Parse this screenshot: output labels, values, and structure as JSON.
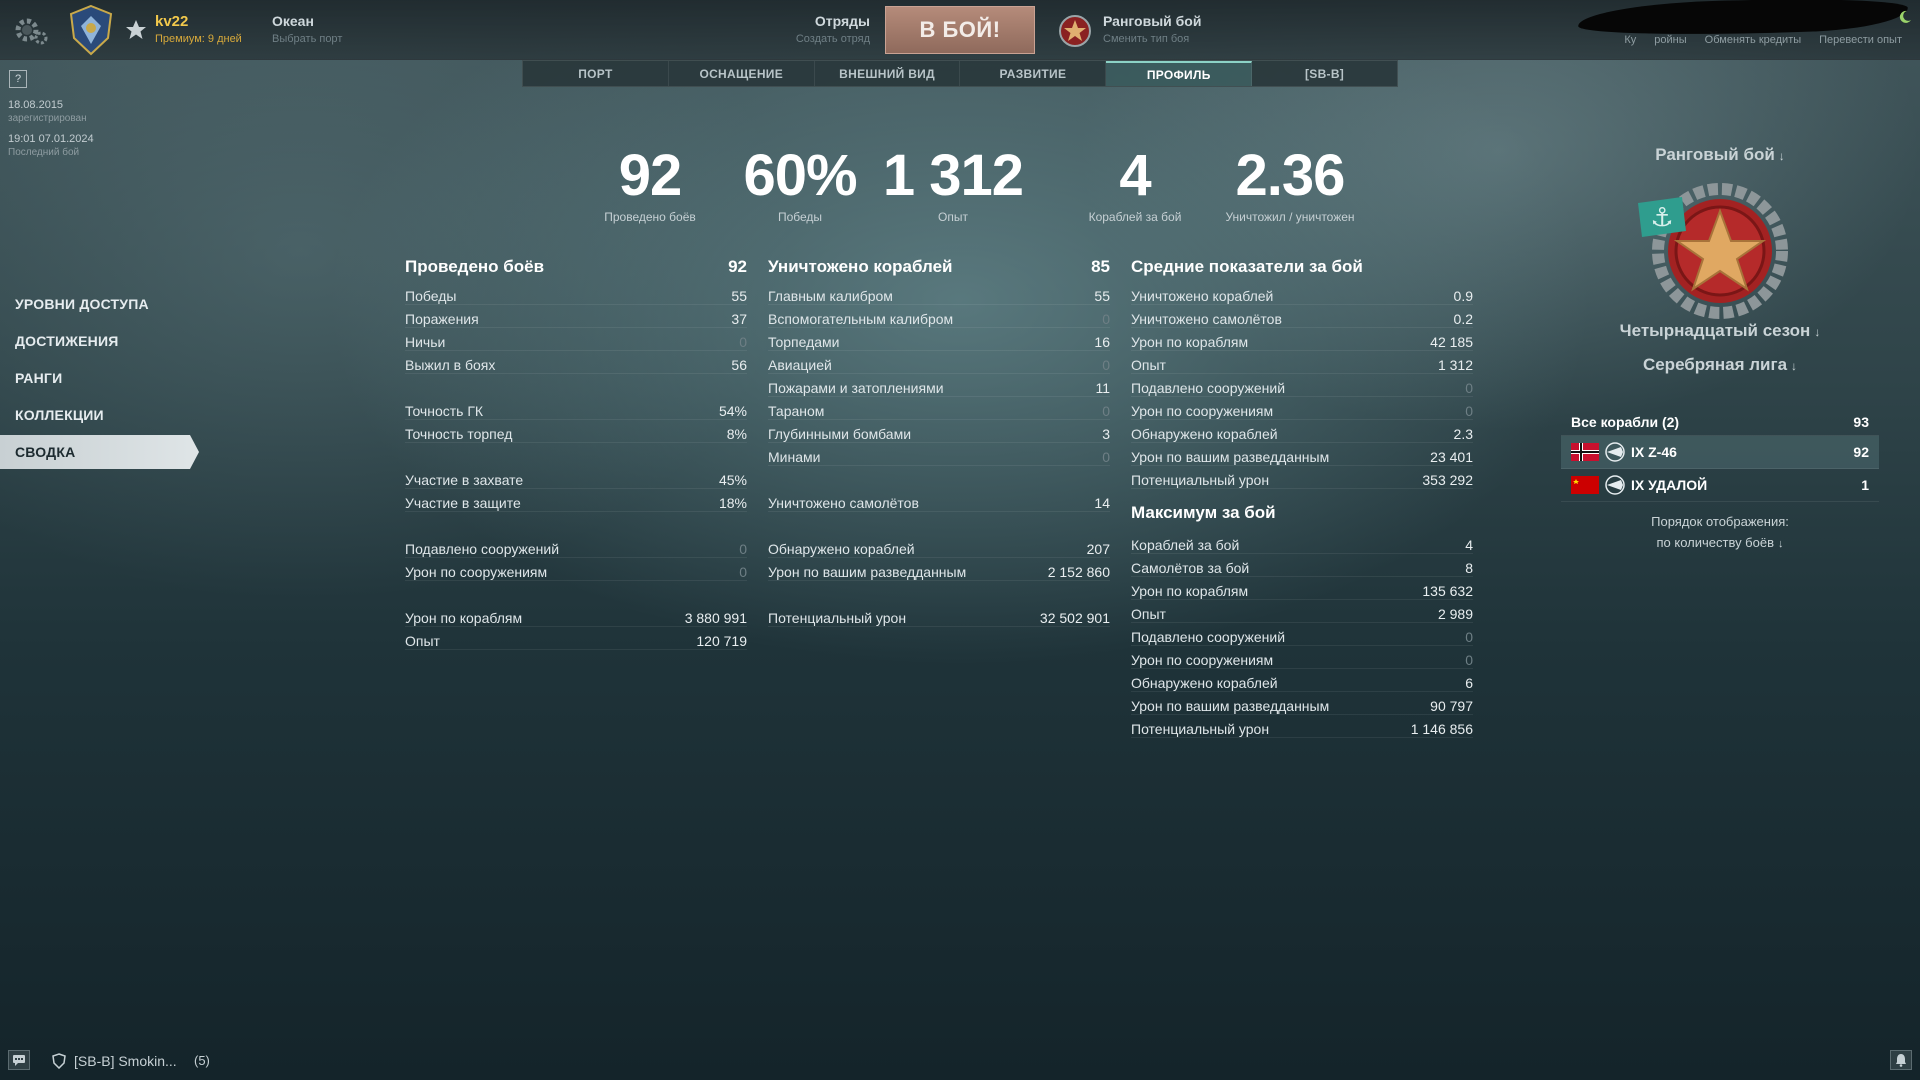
{
  "topbar": {
    "user_name": "kv22",
    "premium": "Премиум: 9 дней",
    "port_name": "Океан",
    "port_sub": "Выбрать порт",
    "squads": "Отряды",
    "squads_sub": "Создать отряд",
    "battle_button": "В БОЙ!",
    "battle_type": "Ранговый бой",
    "battle_type_sub": "Сменить тип боя",
    "links": [
      "Ку",
      "ройны",
      "Обменять кредиты",
      "Перевести опыт"
    ]
  },
  "tabs": [
    {
      "label": "ПОРТ",
      "active": false
    },
    {
      "label": "ОСНАЩЕНИЕ",
      "active": false
    },
    {
      "label": "ВНЕШНИЙ ВИД",
      "active": false
    },
    {
      "label": "РАЗВИТИЕ",
      "active": false
    },
    {
      "label": "ПРОФИЛЬ",
      "active": true
    },
    {
      "label": "[SB-B]",
      "active": false
    }
  ],
  "account": {
    "help": "?",
    "reg_date": "18.08.2015",
    "reg_label": "зарегистрирован",
    "last_battle_date": "19:01  07.01.2024",
    "last_battle_label": "Последний бой"
  },
  "side_menu": [
    {
      "label": "УРОВНИ ДОСТУПА",
      "active": false
    },
    {
      "label": "ДОСТИЖЕНИЯ",
      "active": false
    },
    {
      "label": "РАНГИ",
      "active": false
    },
    {
      "label": "КОЛЛЕКЦИИ",
      "active": false
    },
    {
      "label": "СВОДКА",
      "active": true
    }
  ],
  "summary": [
    {
      "value": "92",
      "label": "Проведено боёв"
    },
    {
      "value": "60%",
      "label": "Победы"
    },
    {
      "value": "1 312",
      "label": "Опыт"
    },
    {
      "value": "4",
      "label": "Кораблей за бой"
    },
    {
      "value": "2.36",
      "label": "Уничтожил / уничтожен"
    }
  ],
  "col1": {
    "title": "Проведено боёв",
    "total": "92",
    "rows": [
      {
        "label": "Победы",
        "value": "55"
      },
      {
        "label": "Поражения",
        "value": "37"
      },
      {
        "label": "Ничьи",
        "value": "0"
      },
      {
        "label": "Выжил в боях",
        "value": "56"
      },
      null,
      {
        "label": "Точность ГК",
        "value": "54%"
      },
      {
        "label": "Точность торпед",
        "value": "8%"
      },
      null,
      {
        "label": "Участие в захвате",
        "value": "45%"
      },
      {
        "label": "Участие в защите",
        "value": "18%"
      },
      null,
      {
        "label": "Подавлено сооружений",
        "value": "0"
      },
      {
        "label": "Урон по сооружениям",
        "value": "0"
      },
      null,
      {
        "label": "Урон по кораблям",
        "value": "3 880 991"
      },
      {
        "label": "Опыт",
        "value": "120 719"
      }
    ]
  },
  "col2": {
    "title": "Уничтожено кораблей",
    "total": "85",
    "rows": [
      {
        "label": "Главным калибром",
        "value": "55"
      },
      {
        "label": "Вспомогательным калибром",
        "value": "0"
      },
      {
        "label": "Торпедами",
        "value": "16"
      },
      {
        "label": "Авиацией",
        "value": "0"
      },
      {
        "label": "Пожарами и затоплениями",
        "value": "11"
      },
      {
        "label": "Тараном",
        "value": "0"
      },
      {
        "label": "Глубинными бомбами",
        "value": "3"
      },
      {
        "label": "Минами",
        "value": "0"
      },
      null,
      {
        "label": "Уничтожено самолётов",
        "value": "14"
      },
      null,
      {
        "label": "Обнаружено кораблей",
        "value": "207"
      },
      {
        "label": "Урон по вашим разведданным",
        "value": "2 152 860"
      },
      null,
      {
        "label": "Потенциальный урон",
        "value": "32 502 901"
      }
    ]
  },
  "col3": {
    "title": "Средние показатели за бой",
    "rows": [
      {
        "label": "Уничтожено кораблей",
        "value": "0.9"
      },
      {
        "label": "Уничтожено самолётов",
        "value": "0.2"
      },
      {
        "label": "Урон по кораблям",
        "value": "42 185"
      },
      {
        "label": "Опыт",
        "value": "1 312"
      },
      {
        "label": "Подавлено сооружений",
        "value": "0"
      },
      {
        "label": "Урон по сооружениям",
        "value": "0"
      },
      {
        "label": "Обнаружено кораблей",
        "value": "2.3"
      },
      {
        "label": "Урон по вашим разведданным",
        "value": "23 401"
      },
      {
        "label": "Потенциальный урон",
        "value": "353 292"
      }
    ],
    "max_title": "Максимум за бой",
    "max_rows": [
      {
        "label": "Кораблей за бой",
        "value": "4"
      },
      {
        "label": "Самолётов за бой",
        "value": "8"
      },
      {
        "label": "Урон по кораблям",
        "value": "135 632"
      },
      {
        "label": "Опыт",
        "value": "2 989"
      },
      {
        "label": "Подавлено сооружений",
        "value": "0"
      },
      {
        "label": "Урон по сооружениям",
        "value": "0"
      },
      {
        "label": "Обнаружено кораблей",
        "value": "6"
      },
      {
        "label": "Урон по вашим разведданным",
        "value": "90 797"
      },
      {
        "label": "Потенциальный урон",
        "value": "1 146 856"
      }
    ]
  },
  "right_panel": {
    "battle_mode": "Ранговый бой",
    "season": "Четырнадцатый сезон",
    "league": "Серебряная лига",
    "all_ships_label": "Все корабли (2)",
    "all_ships_count": "93",
    "ships": [
      {
        "name": "IX Z-46",
        "count": "92",
        "nation": "germany-flag",
        "active": true
      },
      {
        "name": "IX УДАЛОЙ",
        "count": "1",
        "nation": "ussr-flag",
        "active": false
      }
    ],
    "order_label": "Порядок отображения:",
    "order_value": "по количеству боёв"
  },
  "bottom": {
    "clan_chat": "[SB-B] Smokin...",
    "clan_count": "(5)"
  },
  "colors": {
    "accent_gold": "#f2c94c",
    "battle_button": "#a37d6e",
    "active_tab": "#8cd2c6",
    "zero_value": "#6e7f85"
  }
}
